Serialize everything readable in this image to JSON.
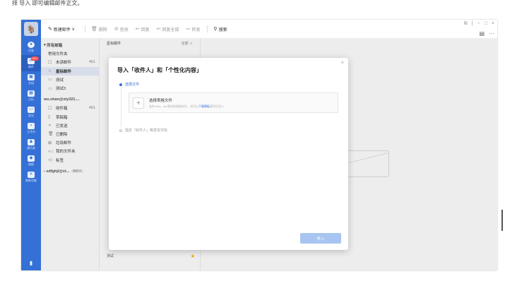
{
  "caption": "择 导入 即可编辑邮件正文。",
  "rail": {
    "avatar_glyph": "🐐",
    "items": [
      {
        "label": "目录",
        "icon": "chat-icon",
        "glyph": "●"
      },
      {
        "label": "邮件",
        "icon": "mail-icon",
        "glyph": "✉",
        "badge": "99+"
      },
      {
        "label": "文档",
        "icon": "doc-icon",
        "glyph": "▣"
      },
      {
        "label": "日历",
        "icon": "calendar-icon",
        "glyph": "▦"
      },
      {
        "label": "会议",
        "icon": "meeting-icon",
        "glyph": "▭"
      },
      {
        "label": "工作台",
        "icon": "workbench-icon",
        "glyph": "▪"
      },
      {
        "label": "通讯录",
        "icon": "contacts-icon",
        "glyph": "♟"
      },
      {
        "label": "超级",
        "icon": "super-icon",
        "glyph": "◆"
      },
      {
        "label": "装新功能",
        "icon": "more-apps-icon",
        "glyph": "✕"
      }
    ],
    "bottom_glyph": "▮"
  },
  "toolbar": {
    "new_mail": "新建邮件",
    "delete": "删除",
    "reject": "拒收",
    "reply": "回复",
    "reply_all": "回复全部",
    "forward": "转发",
    "search": "搜索"
  },
  "folders": {
    "all_mail": "所有邮箱",
    "common": "常用文件夹",
    "unread": "未读邮件",
    "unread_count": "461",
    "starred": "星标邮件",
    "test": "测试",
    "test3": "测试3",
    "account1": "wu.shan@xty321....",
    "inbox": "收件箱",
    "inbox_count": "461",
    "drafts": "草稿箱",
    "sent": "已发送",
    "deleted": "已删除",
    "spam": "垃圾邮件",
    "my_folders": "我的文件夹",
    "tags": "标签",
    "account2": "sdfghjl@xt...",
    "account2_tag": "测试111"
  },
  "list": {
    "header": "星标邮件",
    "filter": "全部 ∨",
    "bottom_item": "测试"
  },
  "modal": {
    "title": "导入「收件人」和「个性化内容」",
    "step1": "选择文件",
    "file_title": "选择表格文件",
    "file_hint_prefix": "支持 xlsx、xls 格式的表格文件，也可以",
    "file_hint_link": "下载模板",
    "file_hint_suffix": "填写后导入",
    "step2": "指定「收件人」等发信字段",
    "import_button": "导入"
  }
}
